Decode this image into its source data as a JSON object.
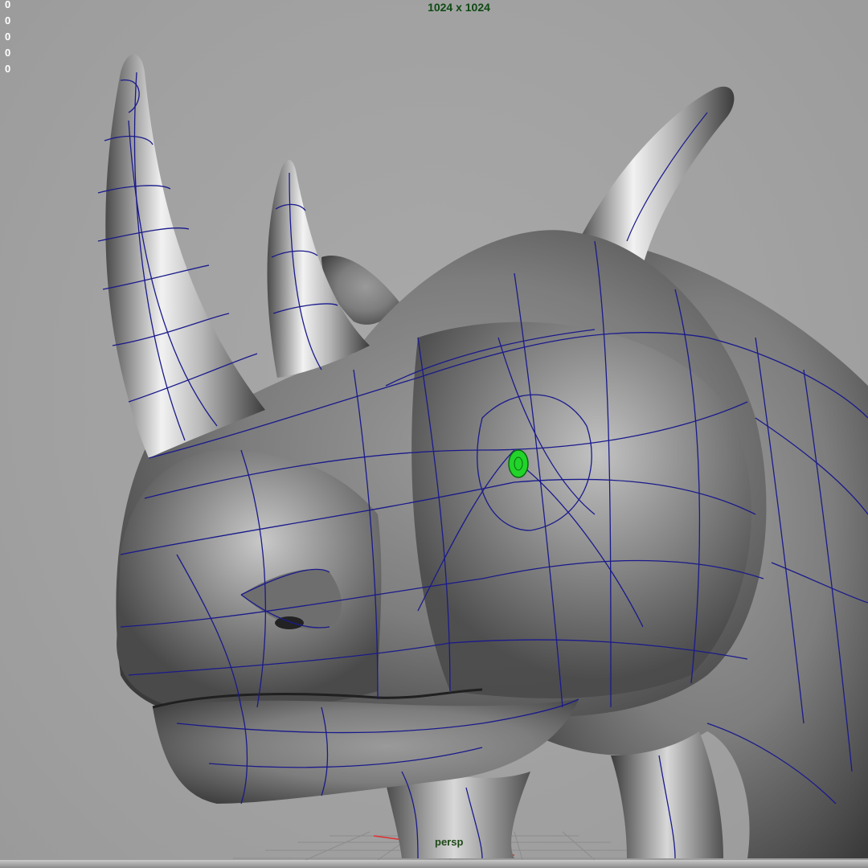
{
  "viewport": {
    "resolution_gate": "1024 x 1024",
    "camera_label": "persp",
    "stats": [
      "0",
      "0",
      "0",
      "0",
      "0"
    ]
  },
  "scene": {
    "model": "rhino-head-subdiv-wireframe",
    "wire_color": "#1a1a8c",
    "selected_color": "#22d42a",
    "background": "#a0a0a0"
  }
}
